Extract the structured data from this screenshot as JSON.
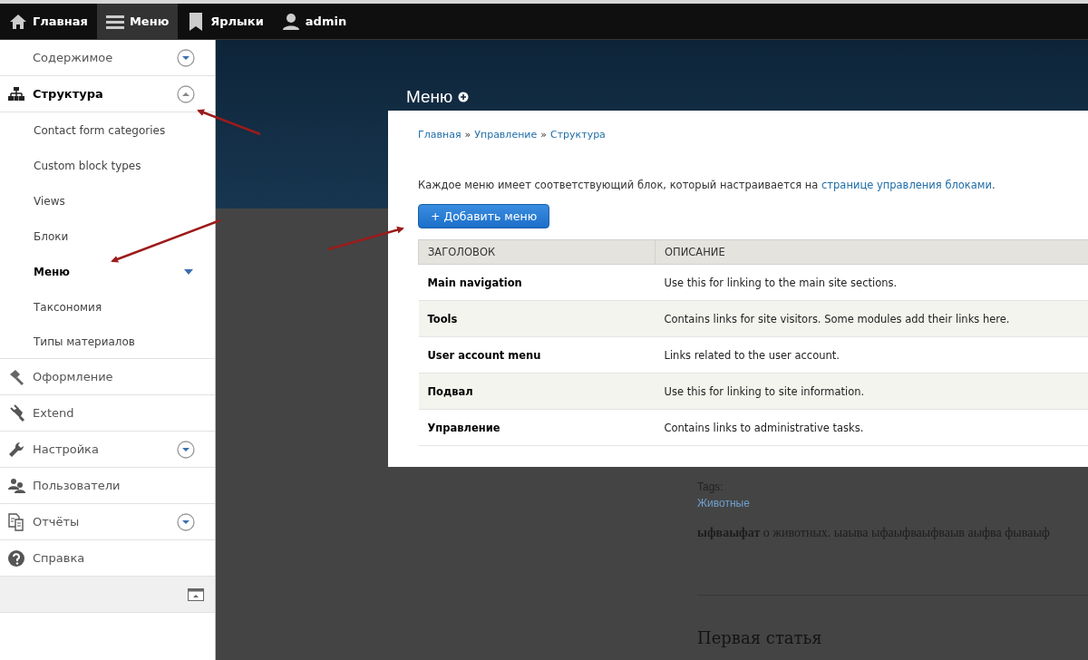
{
  "toolbar": {
    "items": [
      {
        "label": "Главная",
        "selected": false
      },
      {
        "label": "Меню",
        "selected": true
      },
      {
        "label": "Ярлыки",
        "selected": false
      },
      {
        "label": "admin",
        "selected": false
      }
    ]
  },
  "sidebar": {
    "items": [
      {
        "label": "Содержимое",
        "kind": "toggle",
        "expanded": false,
        "selected": false
      },
      {
        "label": "Структура",
        "kind": "toggle",
        "expanded": true,
        "selected": true,
        "children": [
          {
            "label": "Contact form categories",
            "selected": false,
            "expandable": false
          },
          {
            "label": "Custom block types",
            "selected": false,
            "expandable": false
          },
          {
            "label": "Views",
            "selected": false,
            "expandable": false
          },
          {
            "label": "Блоки",
            "selected": false,
            "expandable": false
          },
          {
            "label": "Меню",
            "selected": true,
            "expandable": true
          },
          {
            "label": "Таксономия",
            "selected": false,
            "expandable": false
          },
          {
            "label": "Типы материалов",
            "selected": false,
            "expandable": false
          }
        ]
      },
      {
        "label": "Оформление",
        "kind": "plain",
        "selected": false
      },
      {
        "label": "Extend",
        "kind": "plain",
        "selected": false
      },
      {
        "label": "Настройка",
        "kind": "toggle",
        "expanded": false,
        "selected": false
      },
      {
        "label": "Пользователи",
        "kind": "plain",
        "selected": false
      },
      {
        "label": "Отчёты",
        "kind": "toggle",
        "expanded": false,
        "selected": false
      },
      {
        "label": "Справка",
        "kind": "plain",
        "selected": false
      }
    ]
  },
  "page": {
    "title": "Меню",
    "tags_label": "Tags:",
    "tag": "Животные",
    "paragraph": "**ыфваыфат** о животных. ыаыва ыфаыфваыфваыв аыфва фываыф",
    "next_title": "Первая статья"
  },
  "dialog": {
    "breadcrumb": [
      "Главная",
      "Управление",
      "Структура"
    ],
    "breadcrumb_separator": "»",
    "intro": "Каждое меню имеет соответствующий блок, который настраивается на",
    "intro_link": "странице управления блоками",
    "intro_end": ".",
    "add_button": "+ Добавить меню",
    "table": {
      "columns": [
        "ЗАГОЛОВОК",
        "ОПИСАНИЕ"
      ],
      "rows": [
        {
          "title": "Main navigation",
          "description": "Use this for linking to the main site sections."
        },
        {
          "title": "Tools",
          "description": "Contains links for site visitors. Some modules add their links here."
        },
        {
          "title": "User account menu",
          "description": "Links related to the user account."
        },
        {
          "title": "Подвал",
          "description": "Use this for linking to site information."
        },
        {
          "title": "Управление",
          "description": "Contains links to administrative tasks."
        }
      ]
    }
  }
}
